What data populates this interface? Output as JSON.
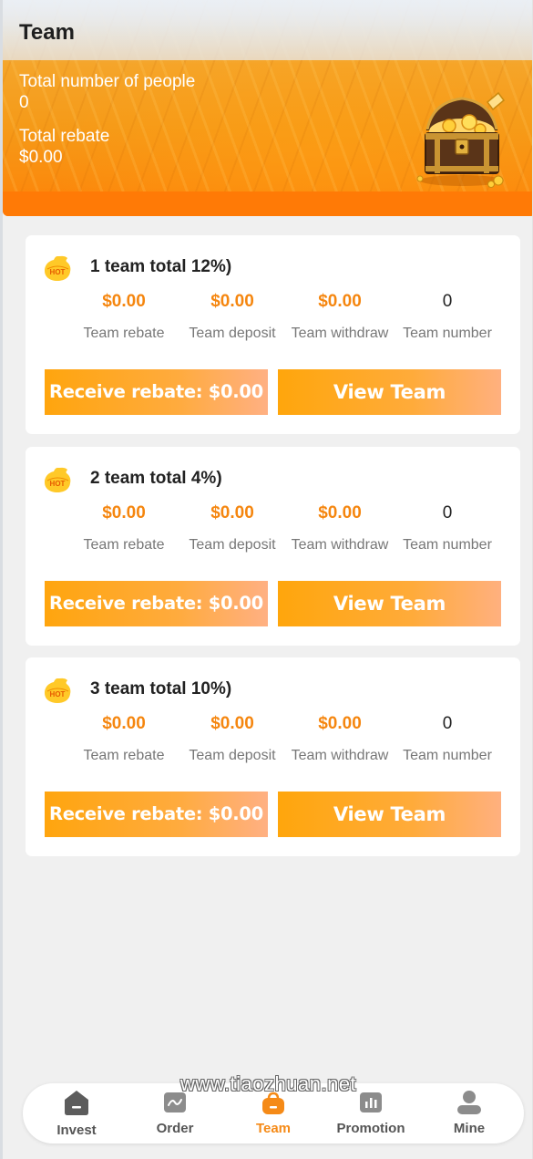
{
  "header": {
    "title": "Team",
    "total_people_label": "Total number of people",
    "total_people_value": "0",
    "total_rebate_label": "Total rebate",
    "total_rebate_value": "$0.00"
  },
  "teams": [
    {
      "title": "1 team total 12%)",
      "hot_badge": "HOT",
      "metrics": [
        {
          "value": "$0.00",
          "label": "Team rebate"
        },
        {
          "value": "$0.00",
          "label": "Team deposit"
        },
        {
          "value": "$0.00",
          "label": "Team withdraw"
        },
        {
          "value": "0",
          "label": "Team number"
        }
      ],
      "receive_label": "Receive rebate: $0.00",
      "view_label": "View Team"
    },
    {
      "title": "2 team total 4%)",
      "hot_badge": "HOT",
      "metrics": [
        {
          "value": "$0.00",
          "label": "Team rebate"
        },
        {
          "value": "$0.00",
          "label": "Team deposit"
        },
        {
          "value": "$0.00",
          "label": "Team withdraw"
        },
        {
          "value": "0",
          "label": "Team number"
        }
      ],
      "receive_label": "Receive rebate: $0.00",
      "view_label": "View Team"
    },
    {
      "title": "3 team total 10%)",
      "hot_badge": "HOT",
      "metrics": [
        {
          "value": "$0.00",
          "label": "Team rebate"
        },
        {
          "value": "$0.00",
          "label": "Team deposit"
        },
        {
          "value": "$0.00",
          "label": "Team withdraw"
        },
        {
          "value": "0",
          "label": "Team number"
        }
      ],
      "receive_label": "Receive rebate: $0.00",
      "view_label": "View Team"
    }
  ],
  "nav": [
    {
      "label": "Invest",
      "icon": "invest-icon",
      "active": false
    },
    {
      "label": "Order",
      "icon": "order-icon",
      "active": false
    },
    {
      "label": "Team",
      "icon": "team-icon",
      "active": true
    },
    {
      "label": "Promotion",
      "icon": "promotion-icon",
      "active": false
    },
    {
      "label": "Mine",
      "icon": "mine-icon",
      "active": false
    }
  ],
  "watermark": "www.tiaozhuan.net",
  "colors": {
    "accent": "#f5860f",
    "hero_orange": "#ff7a06",
    "button_start": "#ffa50e",
    "button_end": "#ffb083",
    "nav_active": "#f58a17",
    "nav_inactive": "#555555"
  }
}
